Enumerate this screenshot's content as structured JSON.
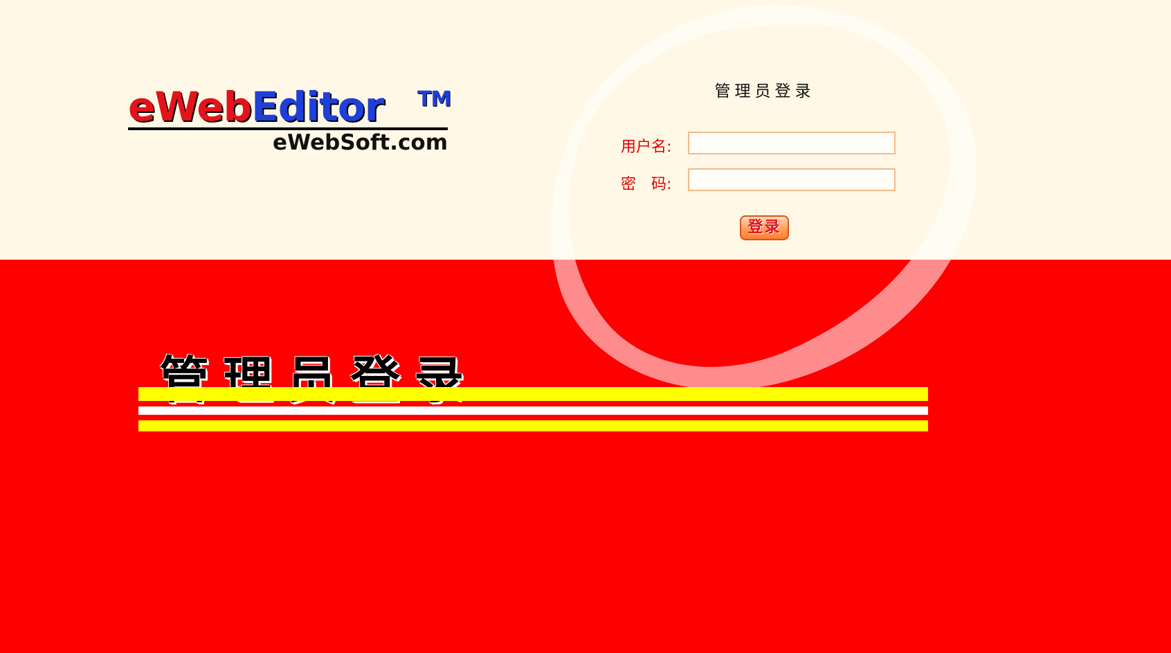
{
  "logo": {
    "brand_e": "e",
    "brand_web": "Web",
    "brand_editor": "Editor",
    "brand_tm": "TM",
    "site": "eWebSoft.com"
  },
  "login": {
    "title": "管理员登录",
    "username_label": "用户名:",
    "username_value": "",
    "password_label": "密　码:",
    "password_value": "",
    "submit_label": "登录"
  },
  "banner": {
    "title": "管理员登录"
  },
  "colors": {
    "top_background": "#fff8e6",
    "bottom_background": "#ff0000",
    "label_color": "#e30000",
    "stripe_yellow": "#ffff00",
    "stripe_white": "#ffffff",
    "input_border": "#f4b98a"
  }
}
